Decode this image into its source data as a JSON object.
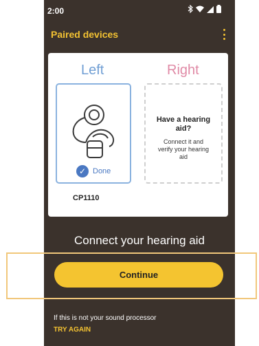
{
  "status_bar": {
    "time": "2:00",
    "icons": [
      "bluetooth-icon",
      "wifi-icon",
      "signal-icon",
      "battery-icon"
    ]
  },
  "app_bar": {
    "title": "Paired devices",
    "menu_icon": "more-vert-icon"
  },
  "card": {
    "left_title": "Left",
    "right_title": "Right",
    "left": {
      "status": "Done",
      "device_name": "CP1110"
    },
    "right": {
      "heading": "Have a hearing aid?",
      "description": "Connect it and verify your hearing aid"
    }
  },
  "main": {
    "title": "Connect your hearing aid",
    "continue_label": "Continue"
  },
  "footer": {
    "text": "If this is not your sound processor",
    "try_again_label": "TRY AGAIN"
  },
  "colors": {
    "background": "#3b322c",
    "accent": "#f3c232",
    "left_accent": "#6f9ed4",
    "right_accent": "#e08aa6",
    "highlight": "#f1c77a"
  }
}
